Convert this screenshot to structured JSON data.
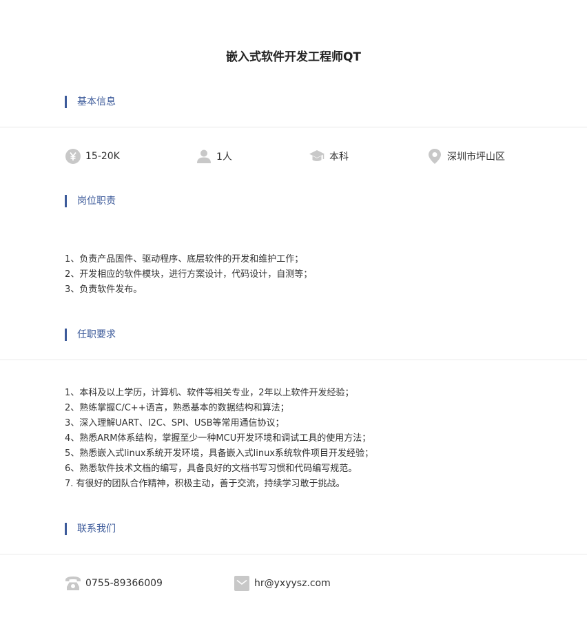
{
  "job": {
    "title": "嵌入式软件开发工程师QT"
  },
  "sections": {
    "basic_info": "基本信息",
    "duties": "岗位职责",
    "requirements": "任职要求",
    "contact": "联系我们"
  },
  "basic_info": {
    "salary": "15-20K",
    "headcount": "1人",
    "education": "本科",
    "location": "深圳市坪山区"
  },
  "duties": [
    "1、负责产品固件、驱动程序、底层软件的开发和维护工作；",
    "2、开发相应的软件模块，进行方案设计，代码设计，自测等；",
    "3、负责软件发布。"
  ],
  "requirements": [
    "1、本科及以上学历，计算机、软件等相关专业，2年以上软件开发经验；",
    "2、熟练掌握C/C++语言，熟悉基本的数据结构和算法；",
    "3、深入理解UART、I2C、SPI、USB等常用通信协议；",
    "4、熟悉ARM体系结构，掌握至少一种MCU开发环境和调试工具的使用方法；",
    "5、熟悉嵌入式linux系统开发环境，具备嵌入式linux系统软件项目开发经验；",
    "6、熟悉软件技术文档的编写，具备良好的文档书写习惯和代码编写规范。",
    "7. 有很好的团队合作精神，积极主动，善于交流，持续学习敢于挑战。"
  ],
  "contact": {
    "phone": "0755-89366009",
    "email": "hr@yxyysz.com"
  },
  "icons": {
    "salary": "yen-icon",
    "headcount": "person-icon",
    "education": "graduation-cap-icon",
    "location": "map-pin-icon",
    "phone": "telephone-icon",
    "email": "envelope-icon"
  },
  "colors": {
    "accent": "#3c5a9a",
    "icon": "#c8c8c8",
    "divider": "#e8e8e8",
    "text": "#333333"
  }
}
